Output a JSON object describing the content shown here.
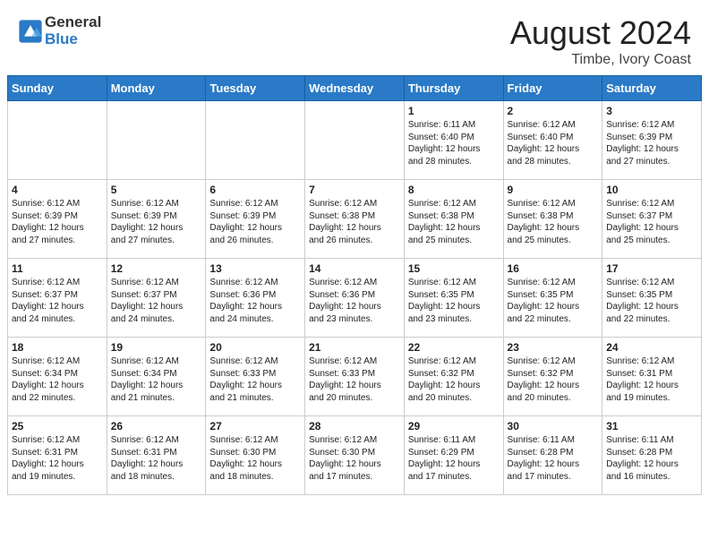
{
  "header": {
    "logo_line1": "General",
    "logo_line2": "Blue",
    "month_year": "August 2024",
    "location": "Timbe, Ivory Coast"
  },
  "weekdays": [
    "Sunday",
    "Monday",
    "Tuesday",
    "Wednesday",
    "Thursday",
    "Friday",
    "Saturday"
  ],
  "weeks": [
    [
      {
        "day": "",
        "info": ""
      },
      {
        "day": "",
        "info": ""
      },
      {
        "day": "",
        "info": ""
      },
      {
        "day": "",
        "info": ""
      },
      {
        "day": "1",
        "info": "Sunrise: 6:11 AM\nSunset: 6:40 PM\nDaylight: 12 hours\nand 28 minutes."
      },
      {
        "day": "2",
        "info": "Sunrise: 6:12 AM\nSunset: 6:40 PM\nDaylight: 12 hours\nand 28 minutes."
      },
      {
        "day": "3",
        "info": "Sunrise: 6:12 AM\nSunset: 6:39 PM\nDaylight: 12 hours\nand 27 minutes."
      }
    ],
    [
      {
        "day": "4",
        "info": "Sunrise: 6:12 AM\nSunset: 6:39 PM\nDaylight: 12 hours\nand 27 minutes."
      },
      {
        "day": "5",
        "info": "Sunrise: 6:12 AM\nSunset: 6:39 PM\nDaylight: 12 hours\nand 27 minutes."
      },
      {
        "day": "6",
        "info": "Sunrise: 6:12 AM\nSunset: 6:39 PM\nDaylight: 12 hours\nand 26 minutes."
      },
      {
        "day": "7",
        "info": "Sunrise: 6:12 AM\nSunset: 6:38 PM\nDaylight: 12 hours\nand 26 minutes."
      },
      {
        "day": "8",
        "info": "Sunrise: 6:12 AM\nSunset: 6:38 PM\nDaylight: 12 hours\nand 25 minutes."
      },
      {
        "day": "9",
        "info": "Sunrise: 6:12 AM\nSunset: 6:38 PM\nDaylight: 12 hours\nand 25 minutes."
      },
      {
        "day": "10",
        "info": "Sunrise: 6:12 AM\nSunset: 6:37 PM\nDaylight: 12 hours\nand 25 minutes."
      }
    ],
    [
      {
        "day": "11",
        "info": "Sunrise: 6:12 AM\nSunset: 6:37 PM\nDaylight: 12 hours\nand 24 minutes."
      },
      {
        "day": "12",
        "info": "Sunrise: 6:12 AM\nSunset: 6:37 PM\nDaylight: 12 hours\nand 24 minutes."
      },
      {
        "day": "13",
        "info": "Sunrise: 6:12 AM\nSunset: 6:36 PM\nDaylight: 12 hours\nand 24 minutes."
      },
      {
        "day": "14",
        "info": "Sunrise: 6:12 AM\nSunset: 6:36 PM\nDaylight: 12 hours\nand 23 minutes."
      },
      {
        "day": "15",
        "info": "Sunrise: 6:12 AM\nSunset: 6:35 PM\nDaylight: 12 hours\nand 23 minutes."
      },
      {
        "day": "16",
        "info": "Sunrise: 6:12 AM\nSunset: 6:35 PM\nDaylight: 12 hours\nand 22 minutes."
      },
      {
        "day": "17",
        "info": "Sunrise: 6:12 AM\nSunset: 6:35 PM\nDaylight: 12 hours\nand 22 minutes."
      }
    ],
    [
      {
        "day": "18",
        "info": "Sunrise: 6:12 AM\nSunset: 6:34 PM\nDaylight: 12 hours\nand 22 minutes."
      },
      {
        "day": "19",
        "info": "Sunrise: 6:12 AM\nSunset: 6:34 PM\nDaylight: 12 hours\nand 21 minutes."
      },
      {
        "day": "20",
        "info": "Sunrise: 6:12 AM\nSunset: 6:33 PM\nDaylight: 12 hours\nand 21 minutes."
      },
      {
        "day": "21",
        "info": "Sunrise: 6:12 AM\nSunset: 6:33 PM\nDaylight: 12 hours\nand 20 minutes."
      },
      {
        "day": "22",
        "info": "Sunrise: 6:12 AM\nSunset: 6:32 PM\nDaylight: 12 hours\nand 20 minutes."
      },
      {
        "day": "23",
        "info": "Sunrise: 6:12 AM\nSunset: 6:32 PM\nDaylight: 12 hours\nand 20 minutes."
      },
      {
        "day": "24",
        "info": "Sunrise: 6:12 AM\nSunset: 6:31 PM\nDaylight: 12 hours\nand 19 minutes."
      }
    ],
    [
      {
        "day": "25",
        "info": "Sunrise: 6:12 AM\nSunset: 6:31 PM\nDaylight: 12 hours\nand 19 minutes."
      },
      {
        "day": "26",
        "info": "Sunrise: 6:12 AM\nSunset: 6:31 PM\nDaylight: 12 hours\nand 18 minutes."
      },
      {
        "day": "27",
        "info": "Sunrise: 6:12 AM\nSunset: 6:30 PM\nDaylight: 12 hours\nand 18 minutes."
      },
      {
        "day": "28",
        "info": "Sunrise: 6:12 AM\nSunset: 6:30 PM\nDaylight: 12 hours\nand 17 minutes."
      },
      {
        "day": "29",
        "info": "Sunrise: 6:11 AM\nSunset: 6:29 PM\nDaylight: 12 hours\nand 17 minutes."
      },
      {
        "day": "30",
        "info": "Sunrise: 6:11 AM\nSunset: 6:28 PM\nDaylight: 12 hours\nand 17 minutes."
      },
      {
        "day": "31",
        "info": "Sunrise: 6:11 AM\nSunset: 6:28 PM\nDaylight: 12 hours\nand 16 minutes."
      }
    ]
  ]
}
